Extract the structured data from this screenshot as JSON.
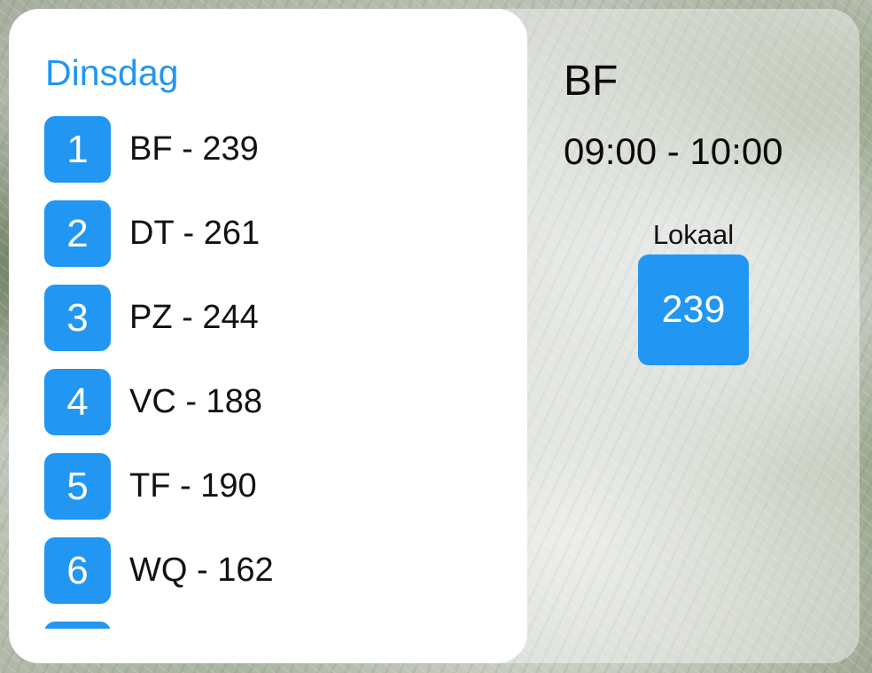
{
  "schedule": {
    "day": "Dinsdag",
    "lessons": [
      {
        "number": "1",
        "label": "BF - 239"
      },
      {
        "number": "2",
        "label": "DT - 261"
      },
      {
        "number": "3",
        "label": "PZ - 244"
      },
      {
        "number": "4",
        "label": "VC - 188"
      },
      {
        "number": "5",
        "label": "TF - 190"
      },
      {
        "number": "6",
        "label": "WQ - 162"
      },
      {
        "number": "",
        "label": ""
      }
    ]
  },
  "detail": {
    "subject": "BF",
    "time": "09:00 - 10:00",
    "room_label": "Lokaal",
    "room": "239"
  },
  "colors": {
    "accent": "#2196f3",
    "panel": "#ffffff",
    "text": "#111111"
  }
}
